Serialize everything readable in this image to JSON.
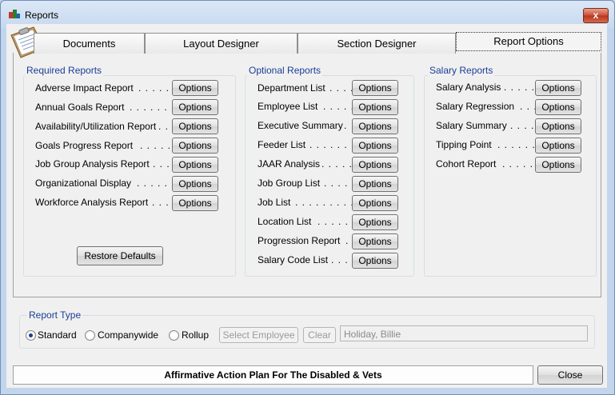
{
  "window": {
    "title": "Reports",
    "close_glyph": "x"
  },
  "tabs": [
    {
      "label": "Documents",
      "active": false
    },
    {
      "label": "Layout Designer",
      "active": false
    },
    {
      "label": "Section Designer",
      "active": false
    },
    {
      "label": "Report Options",
      "active": true
    }
  ],
  "required": {
    "title": "Required Reports",
    "items": [
      {
        "label": "Adverse Impact Report",
        "dots": ". . . . . . . ."
      },
      {
        "label": "Annual Goals Report",
        "dots": ". . . . . . . . . ."
      },
      {
        "label": "Availability/Utilization Report",
        "dots": ". . ."
      },
      {
        "label": "Goals Progress Report",
        "dots": ". . . . . . . ."
      },
      {
        "label": "Job Group Analysis Report",
        "dots": ". . . ."
      },
      {
        "label": "Organizational Display",
        "dots": ". . . . . . . . ."
      },
      {
        "label": "Workforce Analysis Report",
        "dots": ". . . ."
      }
    ],
    "button_label": "Options",
    "restore_label": "Restore Defaults"
  },
  "optional": {
    "title": "Optional Reports",
    "items": [
      {
        "label": "Department List",
        "dots": ". . . ."
      },
      {
        "label": "Employee List",
        "dots": ". . . . . . ."
      },
      {
        "label": "Executive Summary",
        "dots": "."
      },
      {
        "label": "Feeder List",
        "dots": ". . . . . . . . . . ."
      },
      {
        "label": "JAAR Analysis",
        "dots": ". . . . . . ."
      },
      {
        "label": "Job Group List",
        "dots": ". . . . ."
      },
      {
        "label": "Job List",
        "dots": ". . . . . . . . . . . . ."
      },
      {
        "label": "Location List",
        "dots": ". . . . . . . ."
      },
      {
        "label": "Progression Report",
        "dots": "."
      },
      {
        "label": "Salary Code List",
        "dots": ". . . ."
      }
    ],
    "button_label": "Options"
  },
  "salary": {
    "title": "Salary Reports",
    "items": [
      {
        "label": "Salary Analysis",
        "dots": ". . . . . . ."
      },
      {
        "label": "Salary Regression",
        "dots": ". . ."
      },
      {
        "label": "Salary Summary",
        "dots": ". . . . . ."
      },
      {
        "label": "Tipping Point",
        "dots": ". . . . . . . . ."
      },
      {
        "label": "Cohort Report",
        "dots": ". . . . . . . ."
      }
    ],
    "button_label": "Options"
  },
  "report_type": {
    "title": "Report Type",
    "options": [
      {
        "label": "Standard",
        "checked": true
      },
      {
        "label": "Companywide",
        "checked": false
      },
      {
        "label": "Rollup",
        "checked": false
      }
    ],
    "select_employee_label": "Select Employee",
    "clear_label": "Clear",
    "employee_value": "Holiday, Billie"
  },
  "footer": {
    "status_text": "Affirmative Action Plan For The Disabled & Vets",
    "close_label": "Close"
  },
  "colors": {
    "group_title": "#1a3e96",
    "accent": "#1b3f8a"
  }
}
